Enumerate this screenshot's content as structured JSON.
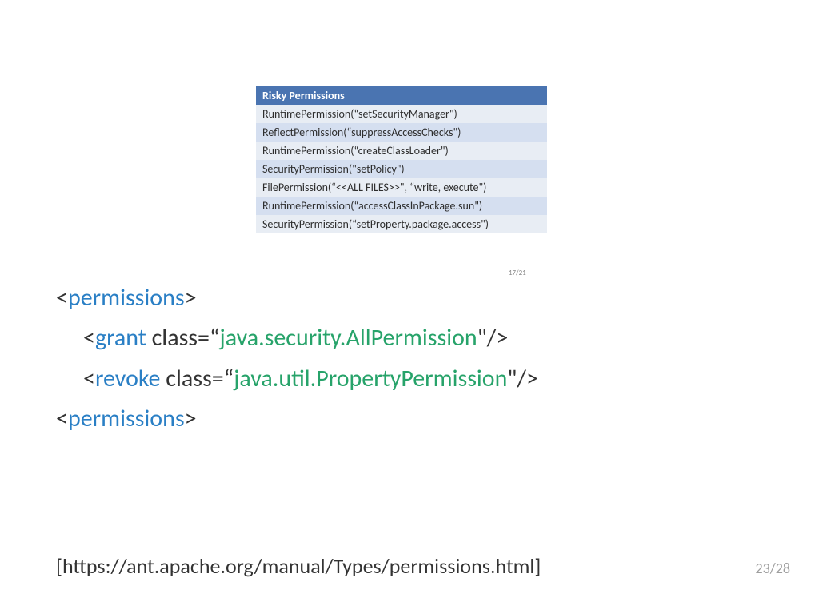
{
  "table": {
    "header": "Risky Permissions",
    "rows": [
      "RuntimePermission(“setSecurityManager\")",
      "ReflectPermission(“suppressAccessChecks\")",
      "RuntimePermission(“createClassLoader\")",
      "SecurityPermission(\"setPolicy\")",
      "FilePermission(“<<ALL FILES>>\", “write, execute\")",
      "RuntimePermission(“accessClassInPackage.sun\")",
      "SecurityPermission(“setProperty.package.access\")"
    ]
  },
  "mini_page": "17/21",
  "code": {
    "open_tag": "permissions",
    "lines": [
      {
        "tag": "grant",
        "attr": "class",
        "value": "java.security.AllPermission"
      },
      {
        "tag": "revoke",
        "attr": "class",
        "value": "java.util.PropertyPermission"
      }
    ],
    "close_tag": "permissions"
  },
  "link": "[https://ant.apache.org/manual/Types/permissions.html]",
  "page_num": "23/28",
  "punct": {
    "lt": "<",
    "gt": ">",
    "selfclose": "\"/>",
    "eqq": "=“"
  }
}
